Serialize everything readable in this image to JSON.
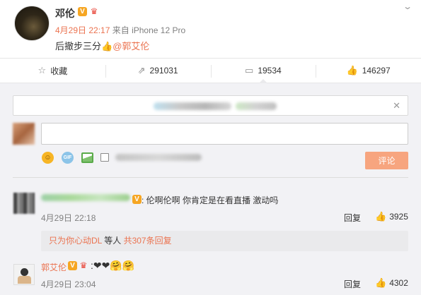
{
  "post": {
    "author": "邓伦",
    "date": "4月29日 22:17",
    "source": "来自 iPhone 12 Pro",
    "text_before": "后撤步三分",
    "emoji": "👍",
    "mention": "@郭艾伦"
  },
  "actions": [
    {
      "icon": "star-icon",
      "label": "收藏"
    },
    {
      "icon": "share-icon",
      "label": "291031"
    },
    {
      "icon": "comment-icon",
      "label": "19534"
    },
    {
      "icon": "thumbs-up-icon",
      "label": "146297"
    }
  ],
  "composer": {
    "input_value": "",
    "submit_label": "评论"
  },
  "comments": [
    {
      "text": "伦啊伦啊  你肯定是在看直播  激动吗",
      "time": "4月29日 22:18",
      "reply_label": "回复",
      "likes": "3925",
      "sub_replies": {
        "prefix": "只为你心动DL",
        "middle": " 等人 ",
        "count": "共307条回复"
      }
    },
    {
      "author": "郭艾伦",
      "text": "❤❤🤗🤗",
      "time": "4月29日 23:04",
      "reply_label": "回复",
      "likes": "4302"
    }
  ],
  "colors": {
    "accent": "#eb7350",
    "submit_bg": "#f7a57f",
    "comment_bg": "#f2f2f5",
    "verified_badge": "#f6a623"
  }
}
